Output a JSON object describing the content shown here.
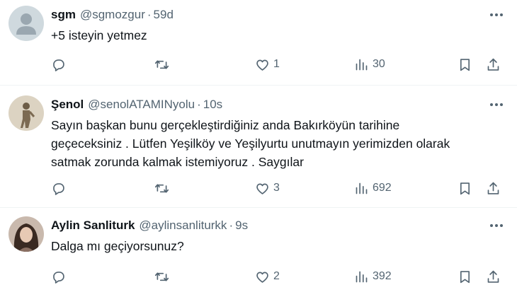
{
  "tweets": [
    {
      "name": "sgm",
      "handle": "@sgmozgur",
      "separator": "·",
      "time": "59d",
      "text": "+5 isteyin yetmez",
      "likes": "1",
      "views": "30"
    },
    {
      "name": "Şenol",
      "handle": "@senolATAMINyolu",
      "separator": "·",
      "time": "10s",
      "text": "Sayın başkan bunu gerçekleştirdiğiniz anda Bakırköyün tarihine\ngeçeceksiniz . Lütfen Yeşilköy ve Yeşilyurtu unutmayın yerimizden olarak\nsatmak zorunda kalmak istemiyoruz . Saygılar",
      "likes": "3",
      "views": "692"
    },
    {
      "name": "Aylin Sanliturk",
      "handle": "@aylinsanliturkk",
      "separator": "·",
      "time": "9s",
      "text": "Dalga mı geçiyorsunuz?",
      "likes": "2",
      "views": "392"
    }
  ],
  "icons": {
    "more": "more-horizontal-icon",
    "reply": "reply-icon",
    "retweet": "retweet-icon",
    "like": "heart-icon",
    "views": "views-icon",
    "bookmark": "bookmark-icon",
    "share": "share-icon"
  },
  "colors": {
    "text": "#0f1419",
    "secondary": "#536471",
    "divider": "#eff3f4"
  }
}
